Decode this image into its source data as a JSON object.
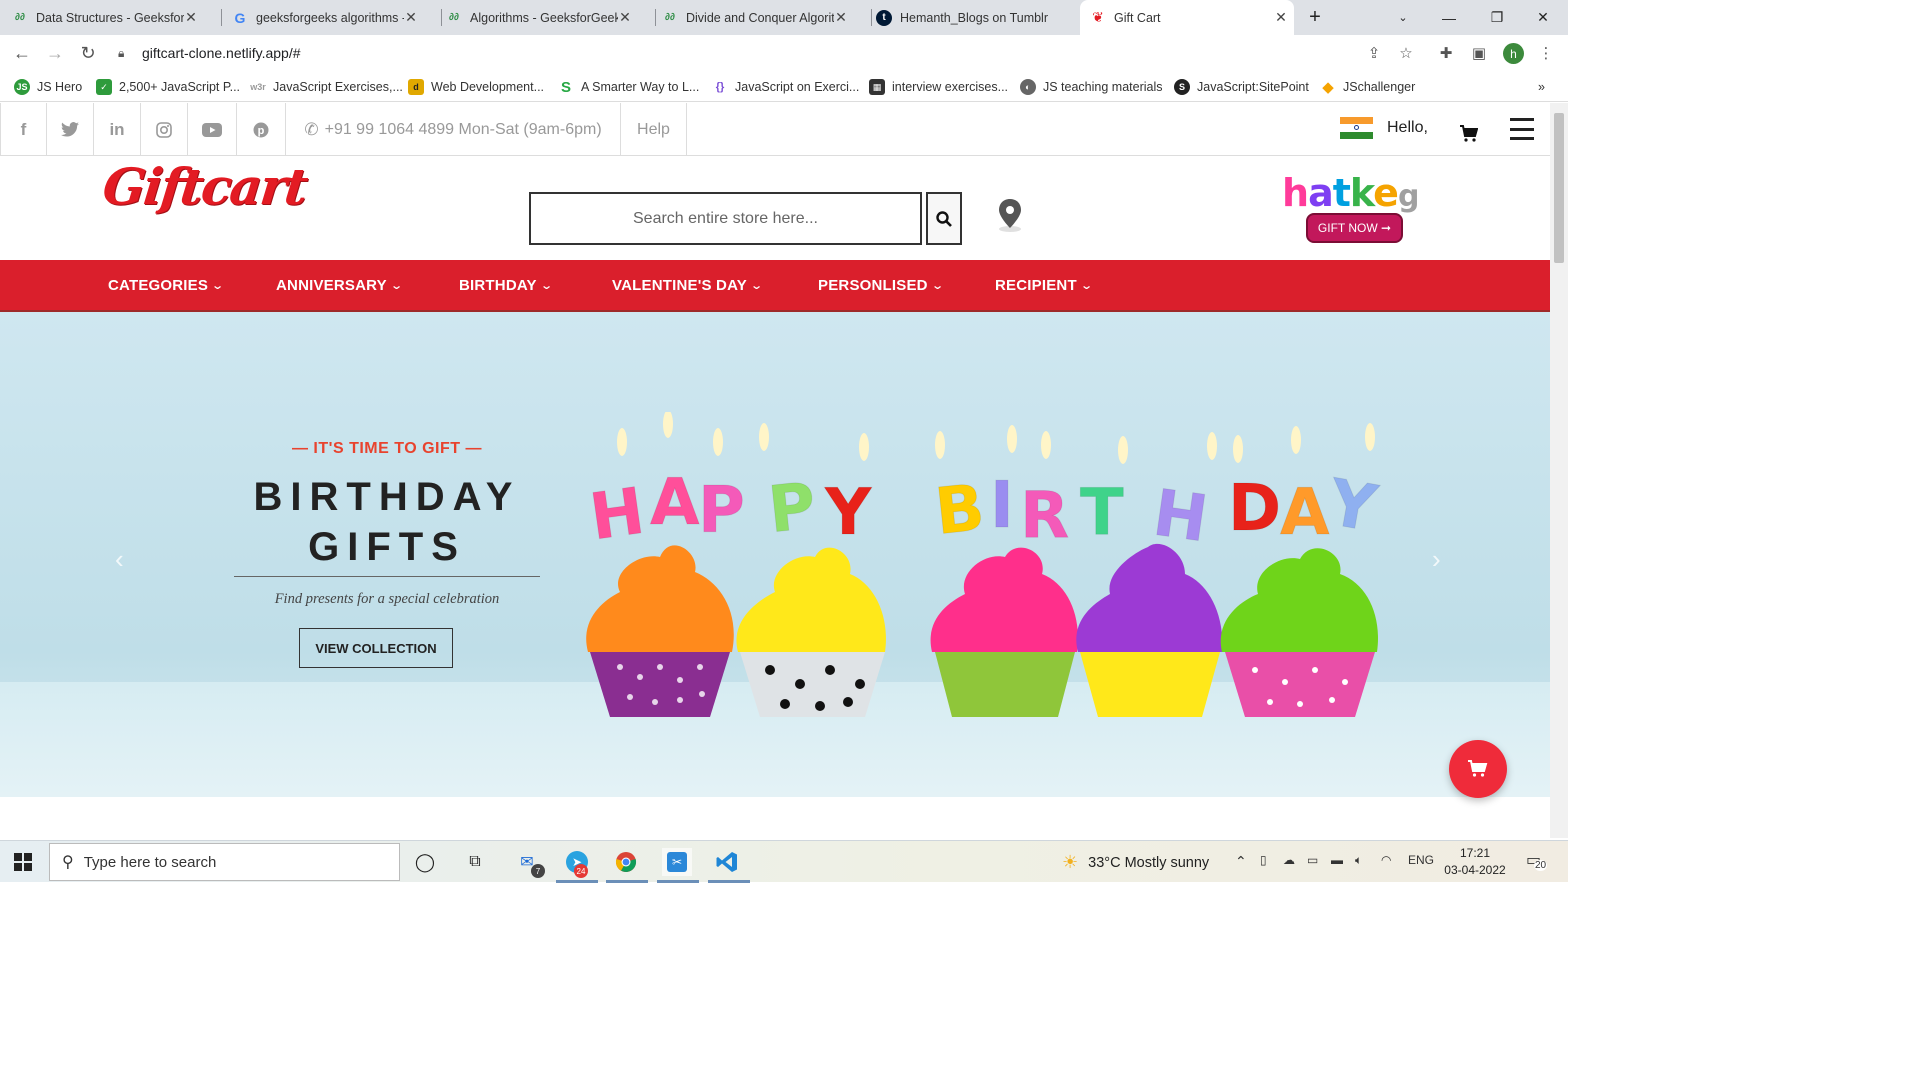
{
  "browser": {
    "tabs": [
      {
        "title": "Data Structures - GeeksforGeeks",
        "icon": "gfg-icon",
        "active": false
      },
      {
        "title": "geeksforgeeks algorithms - Google Search",
        "icon": "google-icon",
        "active": false
      },
      {
        "title": "Algorithms - GeeksforGeeks",
        "icon": "gfg-icon",
        "active": false
      },
      {
        "title": "Divide and Conquer Algorithm",
        "icon": "gfg-icon",
        "active": false
      },
      {
        "title": "Hemanth_Blogs on Tumblr",
        "icon": "tumblr-icon",
        "active": false
      },
      {
        "title": "Gift Cart",
        "icon": "giftcart-icon",
        "active": true
      }
    ],
    "url": "giftcart-clone.netlify.app/#",
    "profile_initial": "h",
    "bookmarks": [
      {
        "label": "JS Hero",
        "color": "#2e9b3c",
        "glyph": "JS"
      },
      {
        "label": "2,500+ JavaScript P...",
        "color": "#2e9b3c",
        "glyph": "✓"
      },
      {
        "label": "JavaScript Exercises,...",
        "color": "#aaaaaa",
        "glyph": "w3"
      },
      {
        "label": "Web Development...",
        "color": "#e0a800",
        "glyph": "d"
      },
      {
        "label": "A Smarter Way to L...",
        "color": "#27a844",
        "glyph": "S"
      },
      {
        "label": "JavaScript on Exerci...",
        "color": "#7b4fd6",
        "glyph": "{}"
      },
      {
        "label": "interview exercises...",
        "color": "#333333",
        "glyph": "▦"
      },
      {
        "label": "JS teaching materials",
        "color": "#666666",
        "glyph": "◐"
      },
      {
        "label": "JavaScript:SitePoint",
        "color": "#222222",
        "glyph": "S"
      },
      {
        "label": "JSchallenger",
        "color": "#f5a300",
        "glyph": "◆"
      }
    ]
  },
  "site": {
    "topbar": {
      "social": [
        "facebook-icon",
        "twitter-icon",
        "linkedin-icon",
        "instagram-icon",
        "youtube-icon",
        "pinterest-icon"
      ],
      "phone": "+91 99 1064 4899 Mon-Sat (9am-6pm)",
      "help": "Help",
      "greeting": "Hello,"
    },
    "logo": "Giftcart",
    "search_placeholder": "Search entire store here...",
    "partner": {
      "word": "hatkeg",
      "button": "GIFT NOW ➞"
    },
    "categories": [
      "CATEGORIES",
      "ANNIVERSARY",
      "BIRTHDAY",
      "VALENTINE'S DAY",
      "PERSONLISED",
      "RECIPIENT"
    ],
    "hero": {
      "tagline": "— IT'S TIME TO GIFT —",
      "heading_line1": "BIRTHDAY",
      "heading_line2": "GIFTS",
      "subtitle": "Find presents for a special celebration",
      "button": "VIEW COLLECTION",
      "image_text": "HAPPY BIRTHDAY"
    }
  },
  "taskbar": {
    "search_placeholder": "Type here to search",
    "mail_badge": "7",
    "telegram_badge": "24",
    "weather": "33°C  Mostly sunny",
    "language": "ENG",
    "time": "17:21",
    "date": "03-04-2022",
    "notifications": "20"
  },
  "colors": {
    "brand_red": "#da1f2c",
    "logo_red": "#e31b23",
    "accent_orange": "#e8432e",
    "gift_now": "#c2185b"
  }
}
